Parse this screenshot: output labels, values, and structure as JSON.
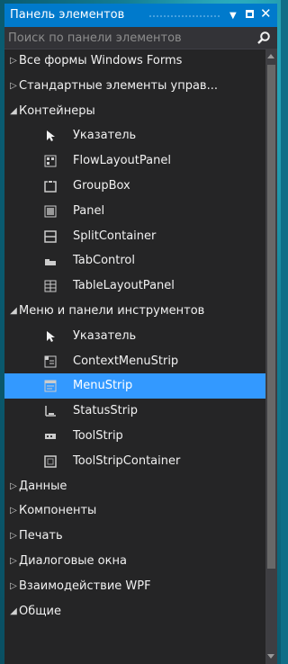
{
  "titlebar": {
    "title": "Панель элементов",
    "dropdown_icon": "dropdown-arrow-icon",
    "dock_icon": "window-position-icon",
    "close_icon": "close-icon"
  },
  "search": {
    "placeholder": "Поиск по панели элементов",
    "icon": "search-icon"
  },
  "tree": [
    {
      "kind": "category",
      "expanded": false,
      "label": "Все формы Windows Forms"
    },
    {
      "kind": "category",
      "expanded": false,
      "label": "Стандартные элементы управ..."
    },
    {
      "kind": "category",
      "expanded": true,
      "label": "Контейнеры"
    },
    {
      "kind": "item",
      "icon": "pointer-icon",
      "label": "Указатель"
    },
    {
      "kind": "item",
      "icon": "flowlayoutpanel-icon",
      "label": "FlowLayoutPanel"
    },
    {
      "kind": "item",
      "icon": "groupbox-icon",
      "label": "GroupBox"
    },
    {
      "kind": "item",
      "icon": "panel-icon",
      "label": "Panel"
    },
    {
      "kind": "item",
      "icon": "splitcontainer-icon",
      "label": "SplitContainer"
    },
    {
      "kind": "item",
      "icon": "tabcontrol-icon",
      "label": "TabControl"
    },
    {
      "kind": "item",
      "icon": "tablelayoutpanel-icon",
      "label": "TableLayoutPanel"
    },
    {
      "kind": "category",
      "expanded": true,
      "label": "Меню и панели инструментов"
    },
    {
      "kind": "item",
      "icon": "pointer-icon",
      "label": "Указатель"
    },
    {
      "kind": "item",
      "icon": "contextmenustrip-icon",
      "label": "ContextMenuStrip"
    },
    {
      "kind": "item",
      "icon": "menustrip-icon",
      "label": "MenuStrip",
      "selected": true
    },
    {
      "kind": "item",
      "icon": "statusstrip-icon",
      "label": "StatusStrip"
    },
    {
      "kind": "item",
      "icon": "toolstrip-icon",
      "label": "ToolStrip"
    },
    {
      "kind": "item",
      "icon": "toolstripcontainer-icon",
      "label": "ToolStripContainer"
    },
    {
      "kind": "category",
      "expanded": false,
      "label": "Данные"
    },
    {
      "kind": "category",
      "expanded": false,
      "label": "Компоненты"
    },
    {
      "kind": "category",
      "expanded": false,
      "label": "Печать"
    },
    {
      "kind": "category",
      "expanded": false,
      "label": "Диалоговые окна"
    },
    {
      "kind": "category",
      "expanded": false,
      "label": "Взаимодействие WPF"
    },
    {
      "kind": "category",
      "expanded": true,
      "label": "Общие"
    }
  ],
  "colors": {
    "titlebar": "#007acc",
    "panel_bg": "#252526",
    "selection": "#3399ff",
    "text": "#f1f1f1"
  }
}
